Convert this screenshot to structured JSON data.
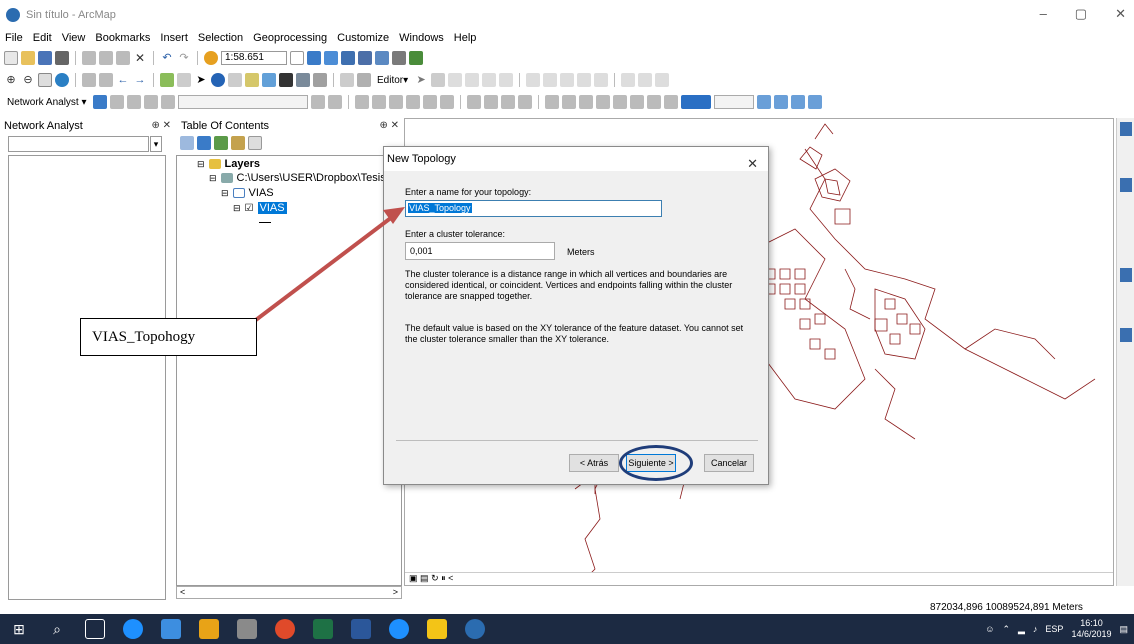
{
  "window": {
    "title": "Sin título - ArcMap",
    "minimize": "–",
    "restore": "▢",
    "close": "✕"
  },
  "menu": [
    "File",
    "Edit",
    "View",
    "Bookmarks",
    "Insert",
    "Selection",
    "Geoprocessing",
    "Customize",
    "Windows",
    "Help"
  ],
  "toolbar": {
    "scale": "1:58.651",
    "editor_label": "Editor▾",
    "network_analyst_label": "Network Analyst ▾"
  },
  "network_analyst_panel": {
    "title": "Network Analyst"
  },
  "toc": {
    "title": "Table Of Contents",
    "layers_label": "Layers",
    "path_label": "C:\\Users\\USER\\Dropbox\\Tesis Casc",
    "dataset_label": "VIAS",
    "layer_label": "VIAS"
  },
  "dialog": {
    "title": "New Topology",
    "name_prompt": "Enter a name for your topology:",
    "name_value": "VIAS_Topology",
    "cluster_prompt": "Enter a cluster tolerance:",
    "cluster_value": "0,001",
    "units": "Meters",
    "description": "The cluster tolerance is a distance range in which all vertices and boundaries are considered identical, or coincident. Vertices and endpoints falling within the cluster tolerance are snapped together.",
    "default_note": "The default value is based on the XY tolerance of the feature dataset. You cannot set the cluster tolerance smaller than the XY tolerance.",
    "back_button": "< Atrás",
    "next_button": "Siguiente >",
    "cancel_button": "Cancelar"
  },
  "annotation": {
    "text": "VIAS_Topohogy"
  },
  "status": {
    "coordinates": "872034,896  10089524,891 Meters"
  },
  "taskbar": {
    "time": "16:10",
    "date": "14/6/2019",
    "language": "ESP"
  },
  "colors": {
    "road_lines": "#8b1a1a",
    "highlight": "#0078d7",
    "arrow": "#c0504d",
    "circle": "#1f3d7a"
  }
}
